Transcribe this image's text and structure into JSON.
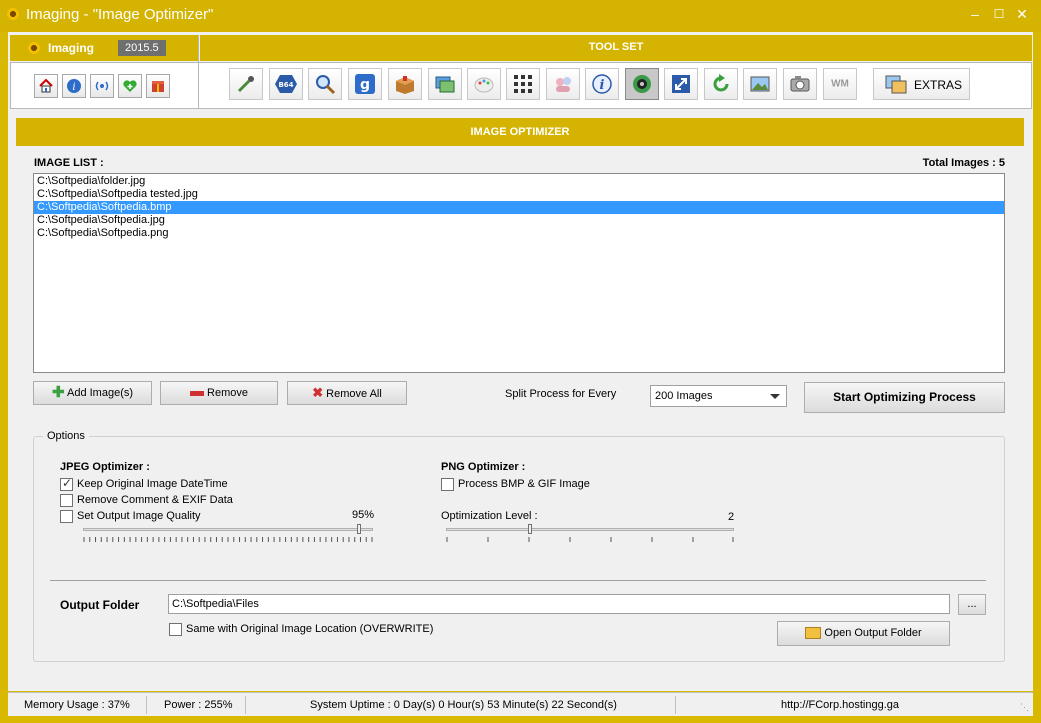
{
  "window": {
    "title": "Imaging - \"Image Optimizer\""
  },
  "brand": {
    "name": "Imaging",
    "version": "2015.5"
  },
  "toolset": {
    "title": "TOOL SET",
    "extras_label": "EXTRAS",
    "wm_label": "WM",
    "b64_label": "B64",
    "google_label": "g"
  },
  "optimizer": {
    "title": "IMAGE OPTIMIZER",
    "image_list_label": "IMAGE LIST :",
    "total_images": "Total Images : 5",
    "images": [
      "C:\\Softpedia\\folder.jpg",
      "C:\\Softpedia\\Softpedia tested.jpg",
      "C:\\Softpedia\\Softpedia.bmp",
      "C:\\Softpedia\\Softpedia.jpg",
      "C:\\Softpedia\\Softpedia.png"
    ],
    "selected_index": 2,
    "add_button": "Add Image(s)",
    "remove_button": "Remove",
    "remove_all_button": "Remove All",
    "split_label": "Split Process for Every",
    "split_value": "200 Images",
    "start_button": "Start Optimizing Process"
  },
  "options": {
    "legend": "Options",
    "jpeg": {
      "title": "JPEG Optimizer :",
      "keep_datetime": {
        "label": "Keep Original Image DateTime",
        "checked": true
      },
      "remove_exif": {
        "label": "Remove Comment & EXIF Data",
        "checked": false
      },
      "set_quality": {
        "label": "Set Output Image Quality",
        "checked": false
      },
      "quality_value": "95%",
      "quality_level": 0.95
    },
    "png": {
      "title": "PNG Optimizer :",
      "process_bmp_gif": {
        "label": "Process BMP & GIF Image",
        "checked": false
      },
      "level_label": "Optimization Level :",
      "level_value": "2",
      "level_fraction": 0.29
    },
    "output_folder_label": "Output Folder",
    "output_folder_value": "C:\\Softpedia\\Files",
    "browse_button": "...",
    "same_location": {
      "label": "Same with Original Image Location (OVERWRITE)",
      "checked": false
    },
    "open_output_button": "Open Output Folder"
  },
  "status": {
    "memory": "Memory Usage : 37%",
    "power": "Power : 255%",
    "uptime": "System Uptime : 0 Day(s) 0 Hour(s) 53 Minute(s) 22 Second(s)",
    "url": "http://FCorp.hostingg.ga"
  },
  "colors": {
    "accent": "#d4b400",
    "selection": "#3399ff"
  }
}
